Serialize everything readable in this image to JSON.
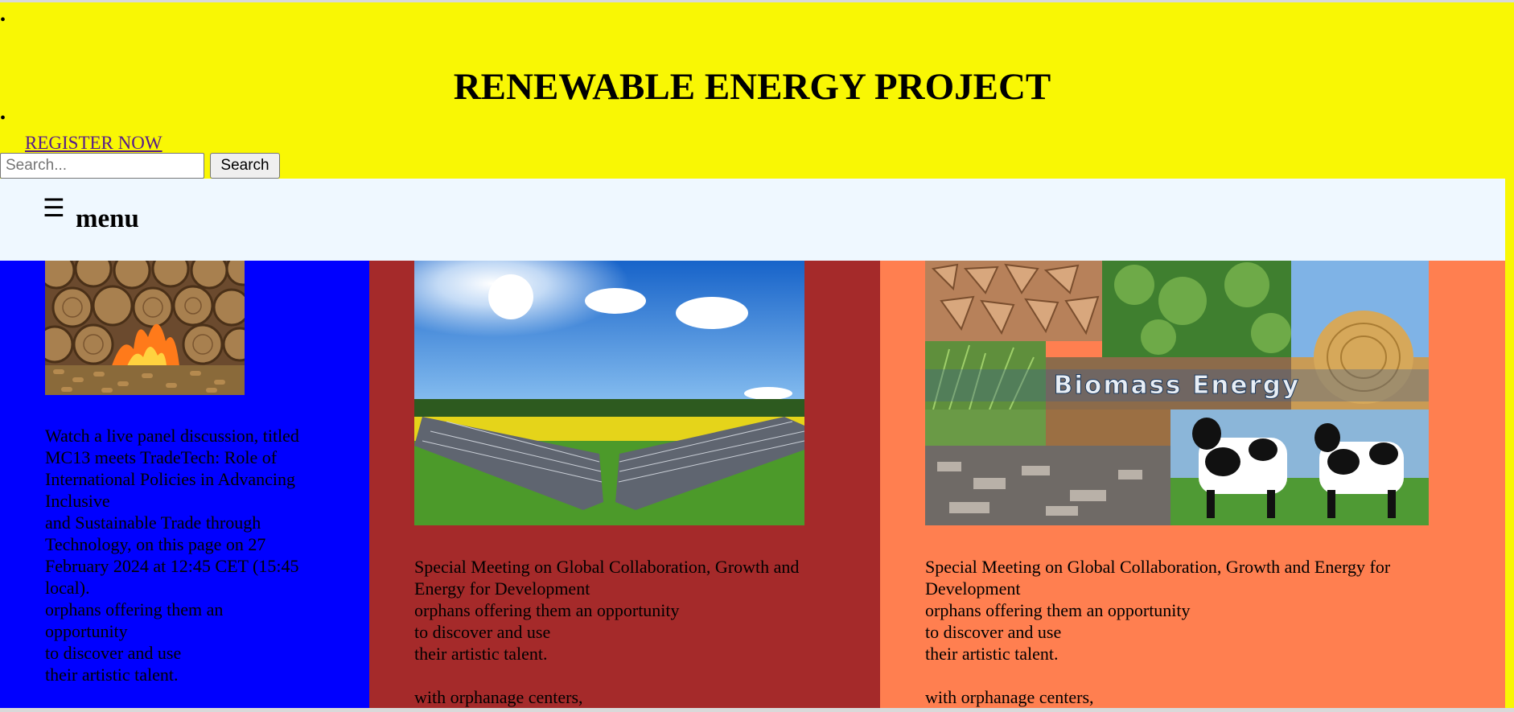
{
  "header": {
    "title": "RENEWABLE ENERGY PROJECT",
    "bullet_1": "•",
    "bullet_2": "•",
    "register_link": "REGISTER NOW",
    "background_color": "#f9f704"
  },
  "search": {
    "placeholder": "Search...",
    "value": "",
    "button_label": "Search"
  },
  "menu": {
    "icon": "hamburger-icon",
    "icon_glyph": "☰",
    "label": "menu",
    "background_color": "#eff8ff"
  },
  "columns": [
    {
      "background_color": "#0000ff",
      "image": "wood-pellet-fire-image",
      "paragraphs": [
        "Watch a live panel discussion, titled MC13 meets TradeTech: Role of International Policies in Advancing Inclusive",
        "and Sustainable Trade through Technology, on this page on 27 February 2024 at 12:45 CET (15:45 local).",
        "orphans offering them an opportunity",
        "to discover and use",
        "their artistic talent."
      ]
    },
    {
      "background_color": "#a52a2a",
      "image": "solar-panels-image",
      "paragraphs": [
        "Special Meeting on Global Collaboration, Growth and Energy for Development",
        "orphans offering them an opportunity",
        "to discover and use",
        "their artistic talent."
      ],
      "after_gap": "with orphanage centers,"
    },
    {
      "background_color": "#ff7f50",
      "image": "biomass-energy-collage-image",
      "image_caption": "Biomass Energy",
      "paragraphs": [
        "Special Meeting on Global Collaboration, Growth and Energy for Development",
        "orphans offering them an opportunity",
        "to discover and use",
        "their artistic talent."
      ],
      "after_gap": "with orphanage centers,"
    }
  ]
}
